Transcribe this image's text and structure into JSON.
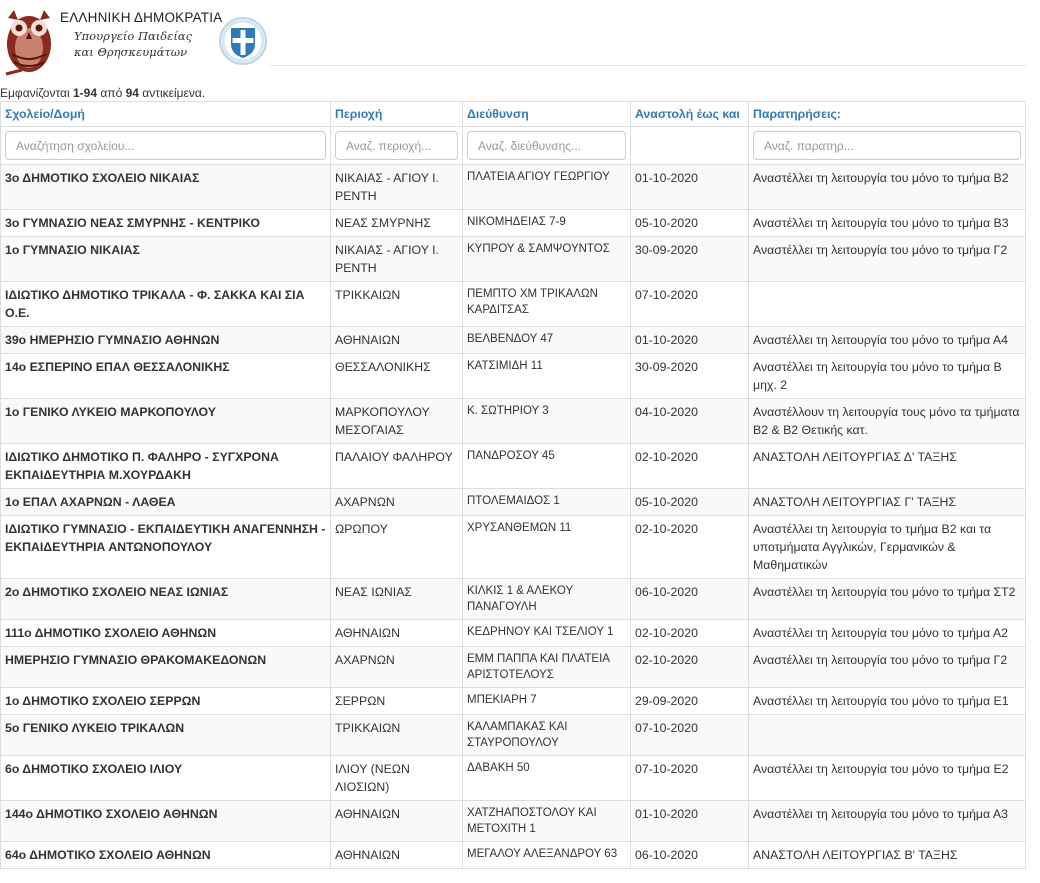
{
  "header": {
    "line1": "ΕΛΛΗΝΙΚΗ ΔΗΜΟΚΡΑΤΙΑ",
    "line2": "Υπουργείο Παιδείας",
    "line3": "και Θρησκευμάτων"
  },
  "summary": {
    "prefix": "Εμφανίζονται ",
    "range": "1-94",
    "middle": " από ",
    "total": "94",
    "suffix": " αντικείμενα."
  },
  "columns": [
    "Σχολείο/Δομή",
    "Περιοχή",
    "Διεύθυνση",
    "Αναστολή έως και",
    "Παρατηρήσεις:"
  ],
  "filters": {
    "school": "Αναζήτηση σχολείου...",
    "region": "Αναζ. περιοχή...",
    "address": "Αναζ. διεύθυνσης...",
    "notes": "Αναζ. παρατηρ..."
  },
  "rows": [
    {
      "school": "3ο ΔΗΜΟΤΙΚΟ ΣΧΟΛΕΙΟ ΝΙΚΑΙΑΣ",
      "region": "ΝΙΚΑΙΑΣ - ΑΓΙΟΥ Ι. ΡΕΝΤΗ",
      "address": "ΠΛΑΤΕΙΑ ΑΓΙΟΥ ΓΕΩΡΓΙΟΥ",
      "date": "01-10-2020",
      "notes": "Αναστέλλει τη λειτουργία του μόνο το τμήμα Β2"
    },
    {
      "school": "3ο ΓΥΜΝΑΣΙΟ ΝΕΑΣ ΣΜΥΡΝΗΣ - ΚΕΝΤΡΙΚΟ",
      "region": "ΝΕΑΣ ΣΜΥΡΝΗΣ",
      "address": "ΝΙΚΟΜΗΔΕΙΑΣ 7-9",
      "date": "05-10-2020",
      "notes": "Αναστέλλει τη λειτουργία του μόνο το τμήμα Β3"
    },
    {
      "school": "1ο ΓΥΜΝΑΣΙΟ ΝΙΚΑΙΑΣ",
      "region": "ΝΙΚΑΙΑΣ - ΑΓΙΟΥ Ι. ΡΕΝΤΗ",
      "address": "ΚΥΠΡΟΥ & ΣΑΜΨΟΥΝΤΟΣ",
      "date": "30-09-2020",
      "notes": "Αναστέλλει τη λειτουργία του μόνο το τμήμα Γ2"
    },
    {
      "school": "ΙΔΙΩΤΙΚΟ ΔΗΜΟΤΙΚΟ ΤΡΙΚΑΛΑ - Φ. ΣΑΚΚΑ ΚΑΙ ΣΙΑ Ο.Ε.",
      "region": "ΤΡΙΚΚΑΙΩΝ",
      "address": "ΠΕΜΠΤΟ ΧΜ ΤΡΙΚΑΛΩΝ ΚΑΡΔΙΤΣΑΣ",
      "date": "07-10-2020",
      "notes": ""
    },
    {
      "school": "39ο ΗΜΕΡΗΣΙΟ ΓΥΜΝΑΣΙΟ ΑΘΗΝΩΝ",
      "region": "ΑΘΗΝΑΙΩΝ",
      "address": "ΒΕΛΒΕΝΔΟΥ 47",
      "date": "01-10-2020",
      "notes": "Αναστέλλει τη λειτουργία του μόνο το τμήμα Α4"
    },
    {
      "school": "14ο ΕΣΠΕΡΙΝΟ ΕΠΑΛ ΘΕΣΣΑΛΟΝΙΚΗΣ",
      "region": "ΘΕΣΣΑΛΟΝΙΚΗΣ",
      "address": "ΚΑΤΣΙΜΙΔΗ 11",
      "date": "30-09-2020",
      "notes": "Αναστέλλει τη λειτουργία του μόνο το τμήμα Β μηχ. 2"
    },
    {
      "school": "1ο ΓΕΝΙΚΟ ΛΥΚΕΙΟ ΜΑΡΚΟΠΟΥΛΟΥ",
      "region": "ΜΑΡΚΟΠΟΥΛΟΥ ΜΕΣΟΓΑΙΑΣ",
      "address": "Κ. ΣΩΤΗΡΙΟΥ 3",
      "date": "04-10-2020",
      "notes": "Αναστέλλουν τη λειτουργία τους μόνο τα τμήματα Β2 & Β2 Θετικής κατ."
    },
    {
      "school": "ΙΔΙΩΤΙΚΟ ΔΗΜΟΤΙΚΟ Π. ΦΑΛΗΡΟ - ΣΥΓΧΡΟΝΑ ΕΚΠΑΙΔΕΥΤΗΡΙΑ Μ.ΧΟΥΡΔΑΚΗ",
      "region": "ΠΑΛΑΙΟΥ ΦΑΛΗΡΟΥ",
      "address": "ΠΑΝΔΡΟΣΟΥ 45",
      "date": "02-10-2020",
      "notes": "ΑΝΑΣΤΟΛΗ ΛΕΙΤΟΥΡΓΙΑΣ Δ' ΤΑΞΗΣ"
    },
    {
      "school": "1ο ΕΠΑΛ ΑΧΑΡΝΩΝ - ΛΑΘΕΑ",
      "region": "ΑΧΑΡΝΩΝ",
      "address": "ΠΤΟΛΕΜΑΙΔΟΣ 1",
      "date": "05-10-2020",
      "notes": "ΑΝΑΣΤΟΛΗ ΛΕΙΤΟΥΡΓΙΑΣ Γ' ΤΑΞΗΣ"
    },
    {
      "school": "ΙΔΙΩΤΙΚΟ ΓΥΜΝΑΣΙΟ - ΕΚΠΑΙΔΕΥΤΙΚΗ ΑΝΑΓΕΝΝΗΣΗ - ΕΚΠΑΙΔΕΥΤΗΡΙΑ ΑΝΤΩΝΟΠΟΥΛΟΥ",
      "region": "ΩΡΩΠΟΥ",
      "address": "ΧΡΥΣΑΝΘΕΜΩΝ 11",
      "date": "02-10-2020",
      "notes": "Αναστέλλει τη λειτουργία το τμήμα Β2 και τα υποτμήματα Αγγλικών, Γερμανικών & Μαθηματικών"
    },
    {
      "school": "2ο ΔΗΜΟΤΙΚΟ ΣΧΟΛΕΙΟ ΝΕΑΣ ΙΩΝΙΑΣ",
      "region": "ΝΕΑΣ ΙΩΝΙΑΣ",
      "address": "ΚΙΛΚΙΣ 1 & ΑΛΕΚΟΥ ΠΑΝΑΓΟΥΛΗ",
      "date": "06-10-2020",
      "notes": "Αναστέλλει τη λειτουργία του μόνο το τμήμα ΣΤ2"
    },
    {
      "school": "111ο ΔΗΜΟΤΙΚΟ ΣΧΟΛΕΙΟ ΑΘΗΝΩΝ",
      "region": "ΑΘΗΝΑΙΩΝ",
      "address": "ΚΕΔΡΗΝΟΥ ΚΑΙ ΤΣΕΛΙΟΥ 1",
      "date": "02-10-2020",
      "notes": "Αναστέλλει τη λειτουργία του μόνο το τμήμα Α2"
    },
    {
      "school": "ΗΜΕΡΗΣΙΟ ΓΥΜΝΑΣΙΟ ΘΡΑΚΟΜΑΚΕΔΟΝΩΝ",
      "region": "ΑΧΑΡΝΩΝ",
      "address": "ΕΜΜ ΠΑΠΠΑ ΚΑΙ ΠΛΑΤΕΙΑ ΑΡΙΣΤΟΤΕΛΟΥΣ",
      "date": "02-10-2020",
      "notes": "Αναστέλλει τη λειτουργία του μόνο το τμήμα Γ2"
    },
    {
      "school": "1ο ΔΗΜΟΤΙΚΟ ΣΧΟΛΕΙΟ ΣΕΡΡΩΝ",
      "region": "ΣΕΡΡΩΝ",
      "address": "ΜΠΕΚΙΑΡΗ 7",
      "date": "29-09-2020",
      "notes": "Αναστέλλει τη λειτουργία του μόνο το τμήμα Ε1"
    },
    {
      "school": "5ο ΓΕΝΙΚΟ ΛΥΚΕΙΟ ΤΡΙΚΑΛΩΝ",
      "region": "ΤΡΙΚΚΑΙΩΝ",
      "address": "ΚΑΛΑΜΠΑΚΑΣ ΚΑΙ ΣΤΑΥΡΟΠΟΥΛΟΥ",
      "date": "07-10-2020",
      "notes": ""
    },
    {
      "school": "6ο ΔΗΜΟΤΙΚΟ ΣΧΟΛΕΙΟ ΙΛΙΟΥ",
      "region": "ΙΛΙΟΥ (ΝΕΩΝ ΛΙΟΣΙΩΝ)",
      "address": "ΔΑΒΑΚΗ 50",
      "date": "07-10-2020",
      "notes": "Αναστέλλει τη λειτουργία του μόνο το τμήμα Ε2"
    },
    {
      "school": "144ο ΔΗΜΟΤΙΚΟ ΣΧΟΛΕΙΟ ΑΘΗΝΩΝ",
      "region": "ΑΘΗΝΑΙΩΝ",
      "address": "ΧΑΤΖΗΑΠΟΣΤΟΛΟΥ ΚΑΙ ΜΕΤΟΧΙΤΗ 1",
      "date": "01-10-2020",
      "notes": "Αναστέλλει τη λειτουργία του μόνο το τμήμα Α3"
    },
    {
      "school": "64ο ΔΗΜΟΤΙΚΟ ΣΧΟΛΕΙΟ ΑΘΗΝΩΝ",
      "region": "ΑΘΗΝΑΙΩΝ",
      "address": "ΜΕΓΑΛΟΥ ΑΛΕΞΑΝΔΡΟΥ 63",
      "date": "06-10-2020",
      "notes": "ΑΝΑΣΤΟΛΗ ΛΕΙΤΟΥΡΓΙΑΣ Β' ΤΑΞΗΣ"
    }
  ]
}
